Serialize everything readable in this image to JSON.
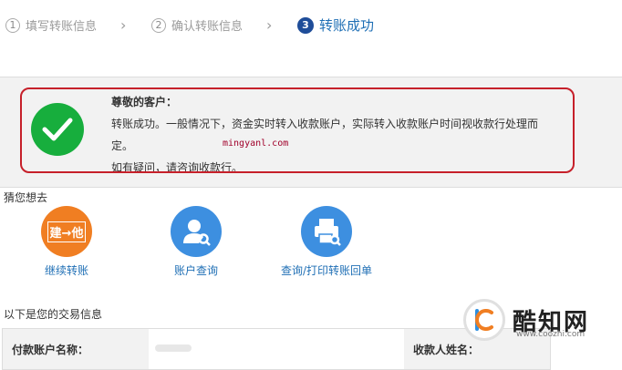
{
  "steps": [
    {
      "num": "1",
      "label": "填写转账信息"
    },
    {
      "num": "2",
      "label": "确认转账信息"
    },
    {
      "num": "3",
      "label": "转账成功"
    }
  ],
  "success": {
    "greeting": "尊敬的客户：",
    "line1": "转账成功。一般情况下，资金实时转入收款账户，实际转入收款账户时间视收款行处理而",
    "line2": "定。",
    "line3": "如有疑问，请咨询收款行。",
    "watermark": "mingyanl.com"
  },
  "guess": {
    "title": "猜您想去",
    "items": [
      {
        "label": "继续转账",
        "icon": "transfer-icon",
        "icon_text": "建→他",
        "color": "#f07e22"
      },
      {
        "label": "账户查询",
        "icon": "user-search-icon",
        "color": "#3d8fe0"
      },
      {
        "label": "查询/打印转账回单",
        "icon": "printer-icon",
        "color": "#3d8fe0"
      }
    ]
  },
  "transaction": {
    "title": "以下是您的交易信息",
    "payer_label": "付款账户名称：",
    "payee_label": "收款人姓名："
  },
  "brand": {
    "name": "酷知网",
    "url": "www.coozhi.com"
  },
  "colors": {
    "accent": "#1f6fb5",
    "success": "#17ae3d",
    "highlight": "#c6202a",
    "orange": "#f07e22"
  }
}
